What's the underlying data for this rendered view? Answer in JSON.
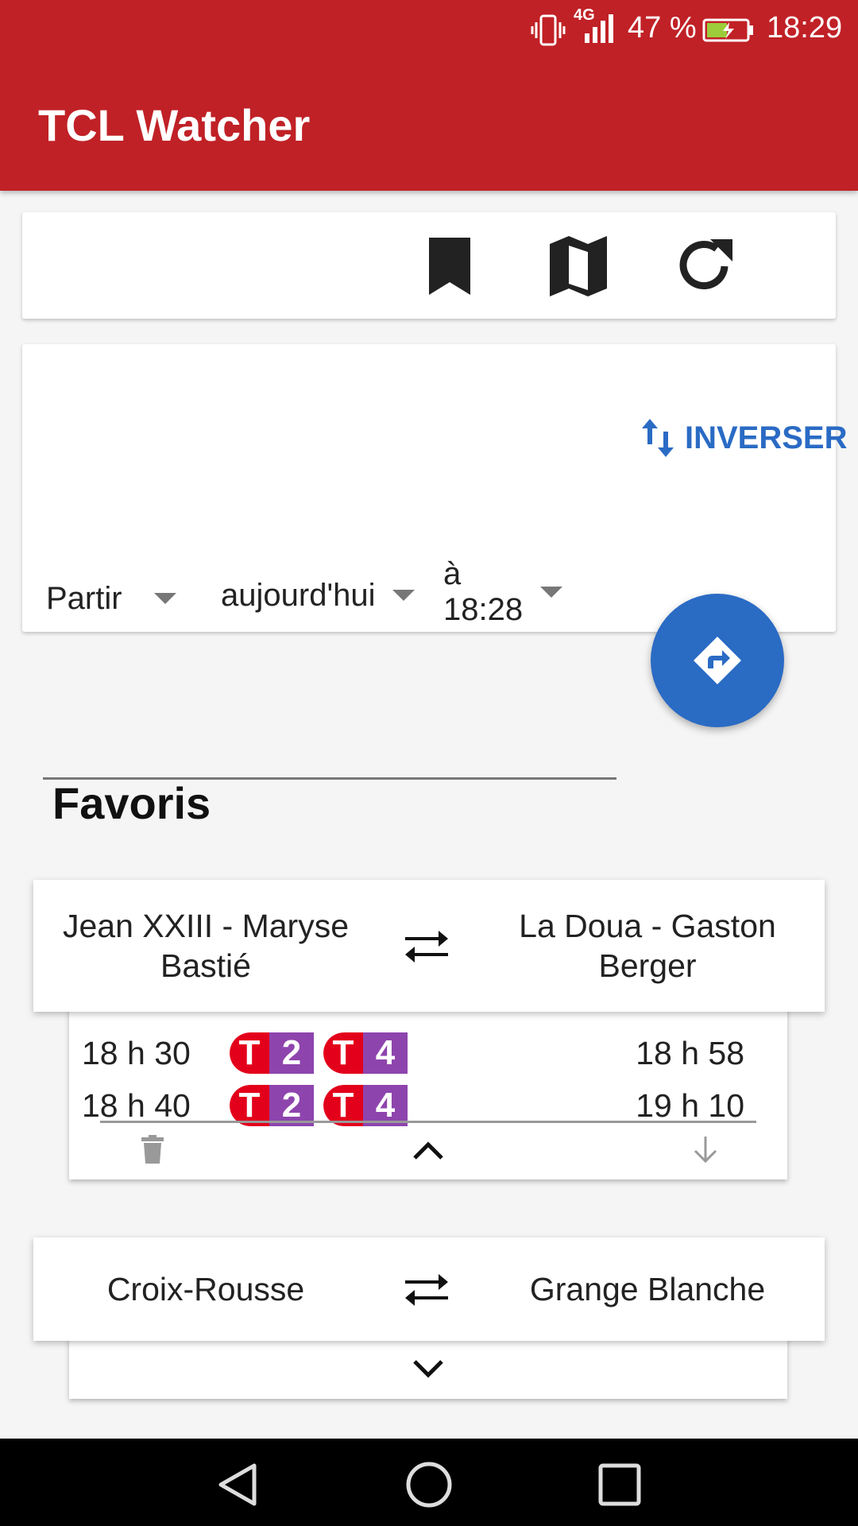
{
  "status_bar": {
    "network": "4G",
    "battery": "47 %",
    "time": "18:29"
  },
  "app": {
    "title": "TCL Watcher"
  },
  "toolbar": {
    "icons": [
      "bookmark-icon",
      "map-icon",
      "refresh-icon"
    ]
  },
  "search": {
    "from_value": "",
    "to_value": "",
    "swap_label": "INVERSER",
    "mode_label": "Partir",
    "day_label": "aujourd'hui",
    "time_label": "à 18:28"
  },
  "favorites": {
    "title": "Favoris",
    "items": [
      {
        "from": "Jean XXIII - Maryse Bastié",
        "to": "La Doua - Gaston Berger",
        "trips": [
          {
            "depart": "18 h 30",
            "arrive": "18 h 58",
            "lines": [
              {
                "t": "T",
                "n": "2"
              },
              {
                "t": "T",
                "n": "4"
              }
            ]
          },
          {
            "depart": "18 h 40",
            "arrive": "19 h 10",
            "lines": [
              {
                "t": "T",
                "n": "2"
              },
              {
                "t": "T",
                "n": "4"
              }
            ]
          }
        ],
        "expanded": true
      },
      {
        "from": "Croix-Rousse",
        "to": "Grange Blanche",
        "trips": [],
        "expanded": false
      }
    ]
  },
  "colors": {
    "primary": "#c02126",
    "accent": "#2a6bc4",
    "tram_red": "#e3001b",
    "tram_purple": "#8e44ad"
  }
}
